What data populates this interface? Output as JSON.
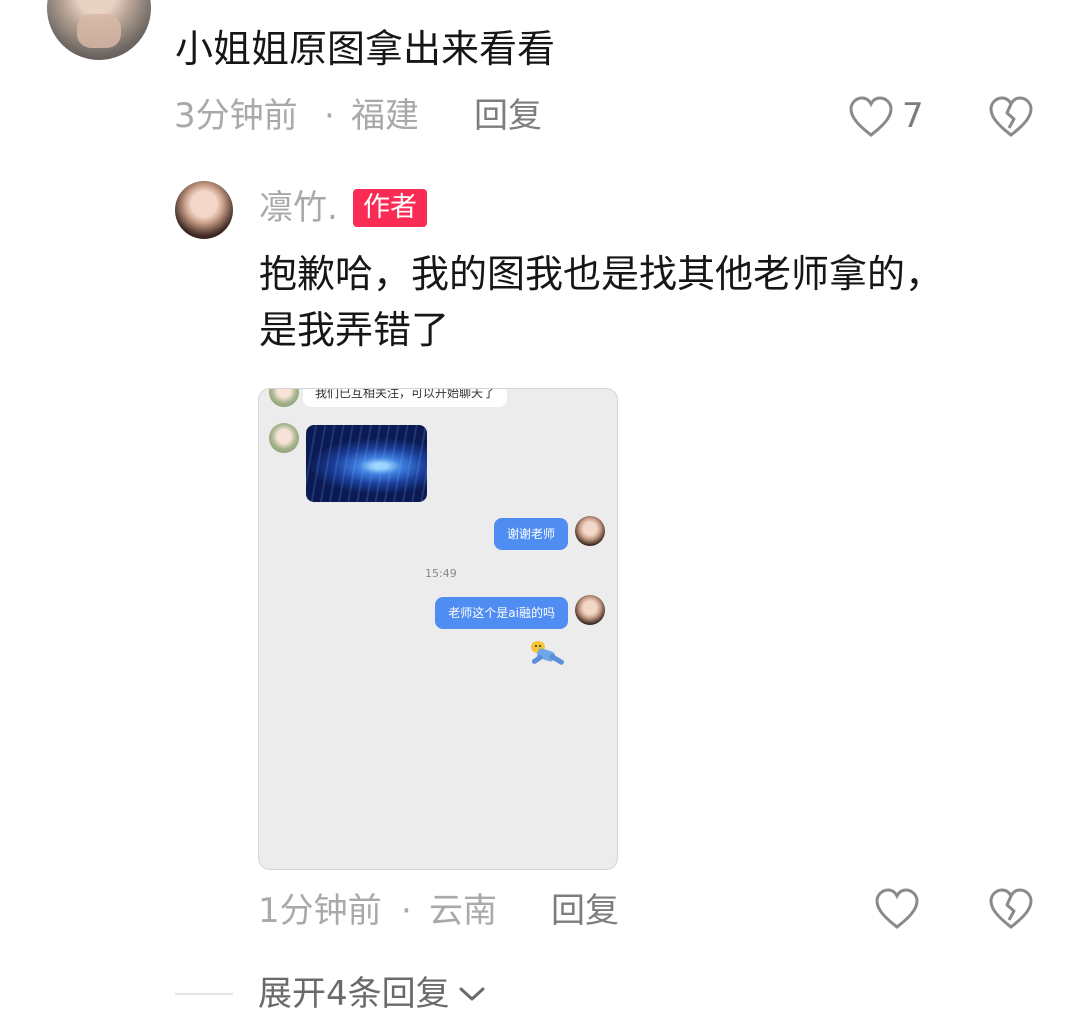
{
  "top_comment": {
    "text": "小姐姐原图拿出来看看",
    "time": "3分钟前",
    "separator": "·",
    "location": "福建",
    "reply_label": "回复",
    "like_count": "7"
  },
  "author_reply": {
    "author_name": "凛竹.",
    "author_badge": "作者",
    "text_line1": "抱歉哈，我的图我也是找其他老师拿的，",
    "text_line2": "是我弄错了",
    "time": "1分钟前",
    "separator": "·",
    "location": "云南",
    "reply_label": "回复",
    "screenshot": {
      "system_message": "我们已互相关注，可以开始聊天了",
      "message_1": "谢谢老师",
      "timestamp": "15:49",
      "message_2": "老师这个是ai融的吗"
    }
  },
  "expand_replies": {
    "label": "展开4条回复"
  },
  "colors": {
    "badge": "#fa2c55",
    "chat_bubble": "#4f8df2",
    "meta_text": "#a9a9a9"
  },
  "icons": [
    "heart-outline-icon",
    "broken-heart-icon",
    "chevron-down-icon"
  ]
}
